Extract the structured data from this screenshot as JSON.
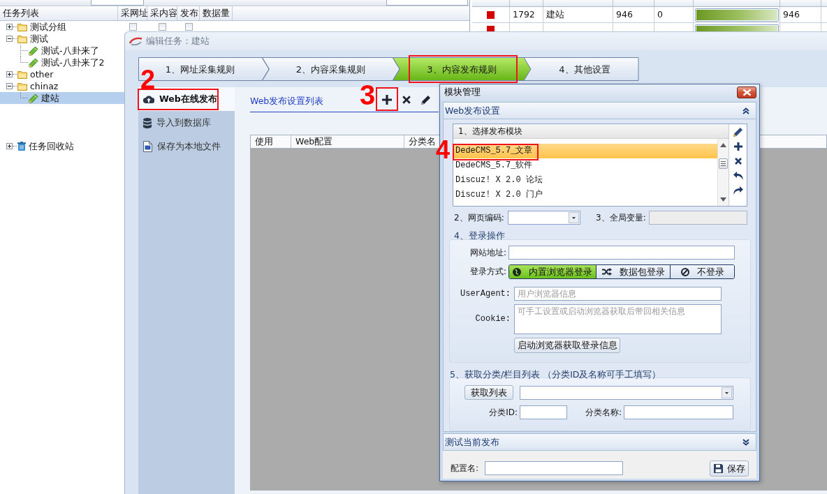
{
  "task_tree": {
    "columns": [
      "任务列表",
      "采网址",
      "采内容",
      "发布",
      "数据量"
    ],
    "items": [
      {
        "label": "测试分组",
        "kind": "folder",
        "expanded": false,
        "selected": false,
        "checkboxes": [
          {
            "checked": false
          },
          {
            "checked": false
          },
          {
            "checked": false
          }
        ]
      },
      {
        "label": "测试",
        "kind": "folder",
        "expanded": true,
        "selected": false,
        "children": [
          {
            "label": "测试-八卦来了",
            "kind": "task",
            "selected": false
          },
          {
            "label": "测试-八卦来了2",
            "kind": "task",
            "selected": false
          }
        ]
      },
      {
        "label": "other",
        "kind": "folder",
        "expanded": false,
        "selected": false
      },
      {
        "label": "chinaz",
        "kind": "folder",
        "expanded": true,
        "selected": false,
        "children": [
          {
            "label": "建站",
            "kind": "task",
            "selected": true
          }
        ]
      },
      {
        "label": "任务回收站",
        "kind": "recycle_bin",
        "expanded": false,
        "selected": false
      }
    ]
  },
  "task_table": {
    "rows": [
      {
        "color": "#d40000",
        "task_id": "1792",
        "task_name": "建站",
        "content_count": "946",
        "published_count": "0",
        "level": 1,
        "requested_count": "946"
      },
      {
        "color": "#d40000",
        "level": 1
      }
    ]
  },
  "edit_window": {
    "title": "编辑任务：建站",
    "steps": [
      {
        "label": "1、网址采集规则",
        "selected": false,
        "highlighted": false
      },
      {
        "label": "2、内容采集规则",
        "selected": false,
        "highlighted": false
      },
      {
        "label": "3、内容发布规则",
        "selected": true,
        "highlighted": true
      },
      {
        "label": "4、其他设置",
        "selected": false,
        "highlighted": false
      }
    ],
    "nav": [
      {
        "label": "Web在线发布",
        "kind": "cloud",
        "selected": true,
        "highlighted": true,
        "annotation": "2"
      },
      {
        "label": "导入到数据库",
        "kind": "database",
        "selected": false,
        "highlighted": false
      },
      {
        "label": "保存为本地文件",
        "kind": "document",
        "selected": false,
        "highlighted": false
      }
    ],
    "publish_list": {
      "title": "Web发布设置列表",
      "tools": [
        {
          "kind": "add",
          "highlighted": true,
          "annotation": "3"
        },
        {
          "kind": "delete",
          "highlighted": false
        },
        {
          "kind": "edit",
          "highlighted": false
        }
      ],
      "columns": [
        "使用",
        "Web配置",
        "分类名"
      ]
    }
  },
  "module_dialog": {
    "title": "模块管理",
    "settings_section": {
      "label": "Web发布设置",
      "expanded": true
    },
    "module_list": {
      "header": "1、选择发布模块",
      "items": [
        {
          "label": "DedeCMS_5.7_文章",
          "selected": true,
          "highlighted": true,
          "annotation": "4"
        },
        {
          "label": "DedeCMS_5.7_软件",
          "selected": false,
          "highlighted": false
        },
        {
          "label": "Discuz! X 2.0 论坛",
          "selected": false,
          "highlighted": false
        },
        {
          "label": "Discuz! X 2.0 门户",
          "selected": false,
          "highlighted": false
        }
      ]
    },
    "encoding_label": "2、网页编码:",
    "global_vars": {
      "label": "3、全局变量:",
      "disabled": true
    },
    "login": {
      "title": "4、登录操作",
      "site_label": "网站地址:",
      "method_label": "登录方式:",
      "methods": [
        {
          "label": "内置浏览器登录",
          "kind": "browser",
          "selected": true
        },
        {
          "label": "数据包登录",
          "kind": "packet",
          "selected": false
        },
        {
          "label": "不登录",
          "kind": "none",
          "selected": false
        }
      ],
      "user_agent": {
        "label": "UserAgent:",
        "placeholder": "用户浏览器信息"
      },
      "cookie": {
        "label": "Cookie:",
        "placeholder": "可手工设置或启动浏览器获取后带回相关信息"
      },
      "launch_button": "启动浏览器获取登录信息"
    },
    "category": {
      "title": "5、获取分类/栏目列表 （分类ID及名称可手工填写）",
      "fetch_button": "获取列表",
      "id_label": "分类ID:",
      "name_label": "分类名称:"
    },
    "test_section": {
      "label": "测试当前发布",
      "expanded": false
    },
    "config_name_label": "配置名:",
    "save_button": "保存"
  }
}
